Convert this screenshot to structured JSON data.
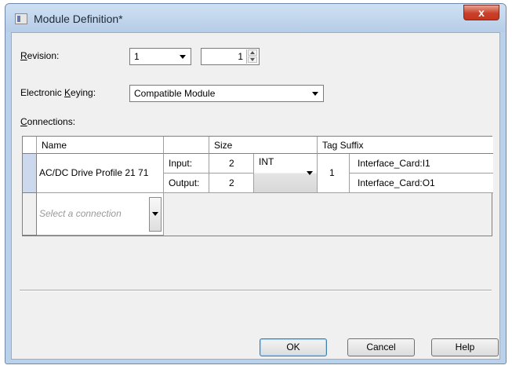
{
  "window": {
    "title": "Module Definition*",
    "close_label": "x"
  },
  "revision": {
    "label_accel": "R",
    "label_rest": "evision:",
    "major": "1",
    "minor": "1"
  },
  "keying": {
    "label_pre": "Electronic ",
    "label_accel": "K",
    "label_rest": "eying:",
    "value": "Compatible Module"
  },
  "connections": {
    "label_accel": "C",
    "label_rest": "onnections:",
    "headers": {
      "name": "Name",
      "size": "Size",
      "tag_suffix": "Tag Suffix"
    },
    "row": {
      "name": "AC/DC Drive Profile 21 71",
      "input_label": "Input:",
      "input_size": "2",
      "output_label": "Output:",
      "output_size": "2",
      "type": "INT",
      "suffix_count": "1",
      "input_tag": "Interface_Card:I1",
      "output_tag": "Interface_Card:O1"
    },
    "placeholder": "Select a connection"
  },
  "buttons": {
    "ok": "OK",
    "cancel": "Cancel",
    "help": "Help"
  }
}
